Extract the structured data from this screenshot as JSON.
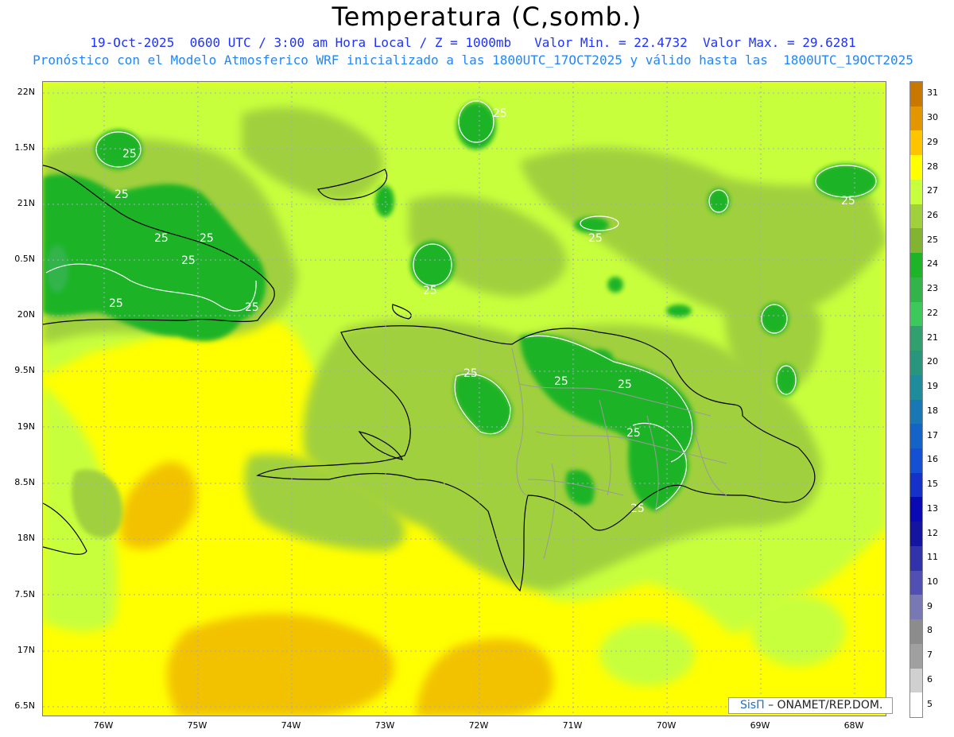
{
  "header": {
    "title": "Temperatura (C,somb.)",
    "line1": "19-Oct-2025  0600 UTC / 3:00 am Hora Local / Z = 1000mb   Valor Min. = 22.4732  Valor Max. = 29.6281",
    "line2": "Pronóstico con el Modelo Atmosferico WRF inicializado a las 1800UTC_17OCT2025 y válido hasta las  1800UTC_19OCT2025"
  },
  "axes": {
    "lat_labels": [
      "22N",
      "1.5N",
      "21N",
      "0.5N",
      "20N",
      "9.5N",
      "19N",
      "8.5N",
      "18N",
      "7.5N",
      "17N",
      "6.5N"
    ],
    "lon_labels": [
      "76W",
      "75W",
      "74W",
      "73W",
      "72W",
      "71W",
      "70W",
      "69W",
      "68W"
    ]
  },
  "contour_label": "25",
  "legend": {
    "levels": [
      "31",
      "30",
      "29",
      "28",
      "27",
      "26",
      "25",
      "24",
      "23",
      "22",
      "21",
      "20",
      "19",
      "18",
      "17",
      "16",
      "15",
      "13",
      "12",
      "11",
      "10",
      "9",
      "8",
      "7",
      "6",
      "5"
    ],
    "colors": [
      "#c87800",
      "#e49600",
      "#ffc400",
      "#ffff00",
      "#c8ff3c",
      "#a0d03c",
      "#82b432",
      "#1eb428",
      "#32b44b",
      "#3cc85a",
      "#32a06e",
      "#28967d",
      "#1e8c9b",
      "#1978b4",
      "#1464c8",
      "#1450d2",
      "#1432c8",
      "#0a0ab4",
      "#1414a0",
      "#3232aa",
      "#5050b4",
      "#7878b4",
      "#8c8c8c",
      "#a0a0a0",
      "#d0d0d0",
      "#ffffff"
    ]
  },
  "credit": {
    "brand": "SisΠ",
    "org": "– ONAMET/REP.DOM."
  }
}
